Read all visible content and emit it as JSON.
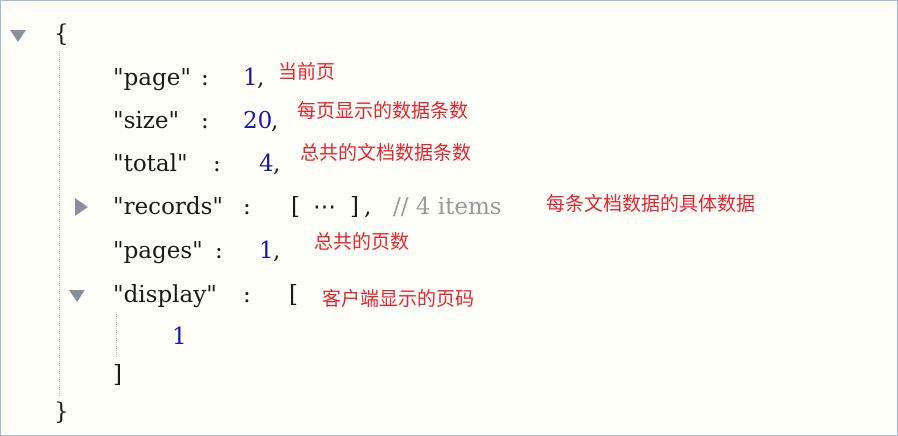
{
  "json": {
    "open_brace": "{",
    "close_brace": "}",
    "rows": {
      "page": {
        "key": "\"page\"",
        "colon": ":",
        "value": "1",
        "comma": ",",
        "note": "当前页"
      },
      "size": {
        "key": "\"size\"",
        "colon": ":",
        "value": "20",
        "comma": ",",
        "note": "每页显示的数据条数"
      },
      "total": {
        "key": "\"total\"",
        "colon": ":",
        "value": "4",
        "comma": ",",
        "note": "总共的文档数据条数"
      },
      "records": {
        "key": "\"records\"",
        "colon": ":",
        "open": "[",
        "ellipsis": "⋯",
        "close": "]",
        "comma": ",",
        "comment": "// 4 items",
        "note": "每条文档数据的具体数据"
      },
      "pages": {
        "key": "\"pages\"",
        "colon": ":",
        "value": "1",
        "comma": ",",
        "note": "总共的页数"
      },
      "display": {
        "key": "\"display\"",
        "colon": ":",
        "open": "[",
        "close": "]",
        "items": [
          "1"
        ],
        "note": "客户端显示的页码"
      }
    }
  },
  "icons": {
    "root_toggle": "triangle-down-icon",
    "records_toggle": "triangle-right-icon",
    "display_toggle": "triangle-down-icon"
  }
}
